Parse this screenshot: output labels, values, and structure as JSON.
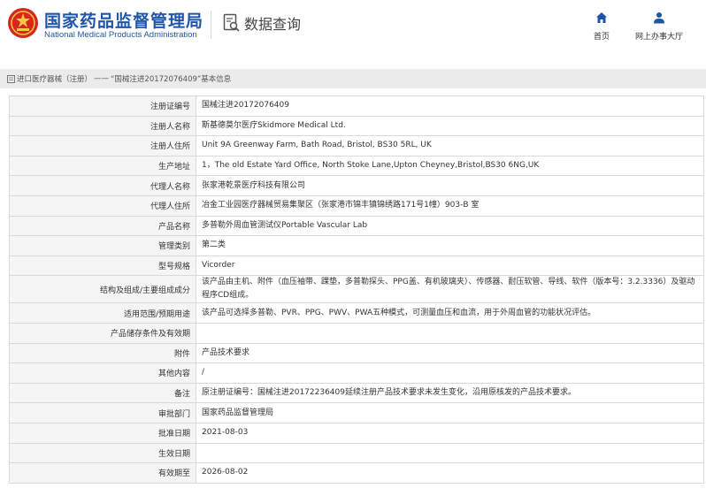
{
  "header": {
    "brand_cn": "国家药品监督管理局",
    "brand_en": "National Medical Products Administration",
    "query_title": "数据查询",
    "nav_home": "首页",
    "nav_hall": "网上办事大厅",
    "brand_color": "#1f56a8",
    "logo_color": "#d7261e"
  },
  "breadcrumb": {
    "root": "进口医疗器械（注册）",
    "separator": "——",
    "current": "“国械注进20172076409”基本信息"
  },
  "rows": [
    {
      "label": "注册证编号",
      "value": "国械注进20172076409"
    },
    {
      "label": "注册人名称",
      "value": "斯基德莫尔医疗Skidmore Medical Ltd."
    },
    {
      "label": "注册人住所",
      "value": "Unit 9A Greenway Farm, Bath Road, Bristol, BS30 5RL, UK"
    },
    {
      "label": "生产地址",
      "value": "1，The old Estate Yard Office, North Stoke Lane,Upton Cheyney,Bristol,BS30 6NG,UK"
    },
    {
      "label": "代理人名称",
      "value": "张家港乾景医疗科技有限公司"
    },
    {
      "label": "代理人住所",
      "value": "冶金工业园医疗器械贸易集聚区（张家港市锦丰镇锦绣路171号1幢）903-B 室"
    },
    {
      "label": "产品名称",
      "value": "多普勒外周血管测试仪Portable Vascular Lab"
    },
    {
      "label": "管理类别",
      "value": "第二类"
    },
    {
      "label": "型号规格",
      "value": "Vicorder"
    },
    {
      "label": "结构及组成/主要组成成分",
      "value": "该产品由主机、附件（血压袖带、踝垫，多普勒探头、PPG盖、有机玻璃夹）、传感器、耐压软管、导线、软件（版本号：3.2.3336）及驱动程序CD组成。"
    },
    {
      "label": "适用范围/预期用途",
      "value": "该产品可选择多普勒、PVR、PPG、PWV、PWA五种模式，可测量血压和血流，用于外周血管的功能状况评估。"
    },
    {
      "label": "产品储存条件及有效期",
      "value": ""
    },
    {
      "label": "附件",
      "value": "产品技术要求"
    },
    {
      "label": "其他内容",
      "value": "/"
    },
    {
      "label": "备注",
      "value": "原注册证编号：国械注进20172236409延续注册产品技术要求未发生变化，沿用原核发的产品技术要求。"
    },
    {
      "label": "审批部门",
      "value": "国家药品监督管理局"
    },
    {
      "label": "批准日期",
      "value": "2021-08-03"
    },
    {
      "label": "生效日期",
      "value": ""
    },
    {
      "label": "有效期至",
      "value": "2026-08-02"
    }
  ]
}
